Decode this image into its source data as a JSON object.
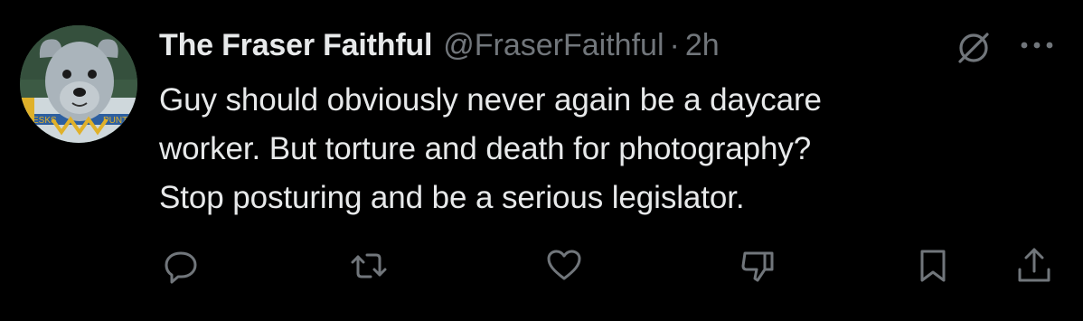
{
  "tweet": {
    "author": {
      "display_name": "The Fraser Faithful",
      "handle": "@FraserFaithful",
      "separator": "·",
      "time": "2h",
      "avatar_icon": "mascot-avatar"
    },
    "text": "Guy should obviously never again be a daycare\nworker. But torture and death for photography?\nStop posturing and be a serious legislator.",
    "header_icons": [
      "grok-icon",
      "more-options-icon"
    ],
    "actions": [
      "reply-icon",
      "repost-icon",
      "like-icon",
      "dislike-icon",
      "bookmark-icon",
      "share-icon"
    ]
  },
  "colors": {
    "background": "#000000",
    "primary_text": "#e7e9ea",
    "secondary_text": "#71767b"
  }
}
